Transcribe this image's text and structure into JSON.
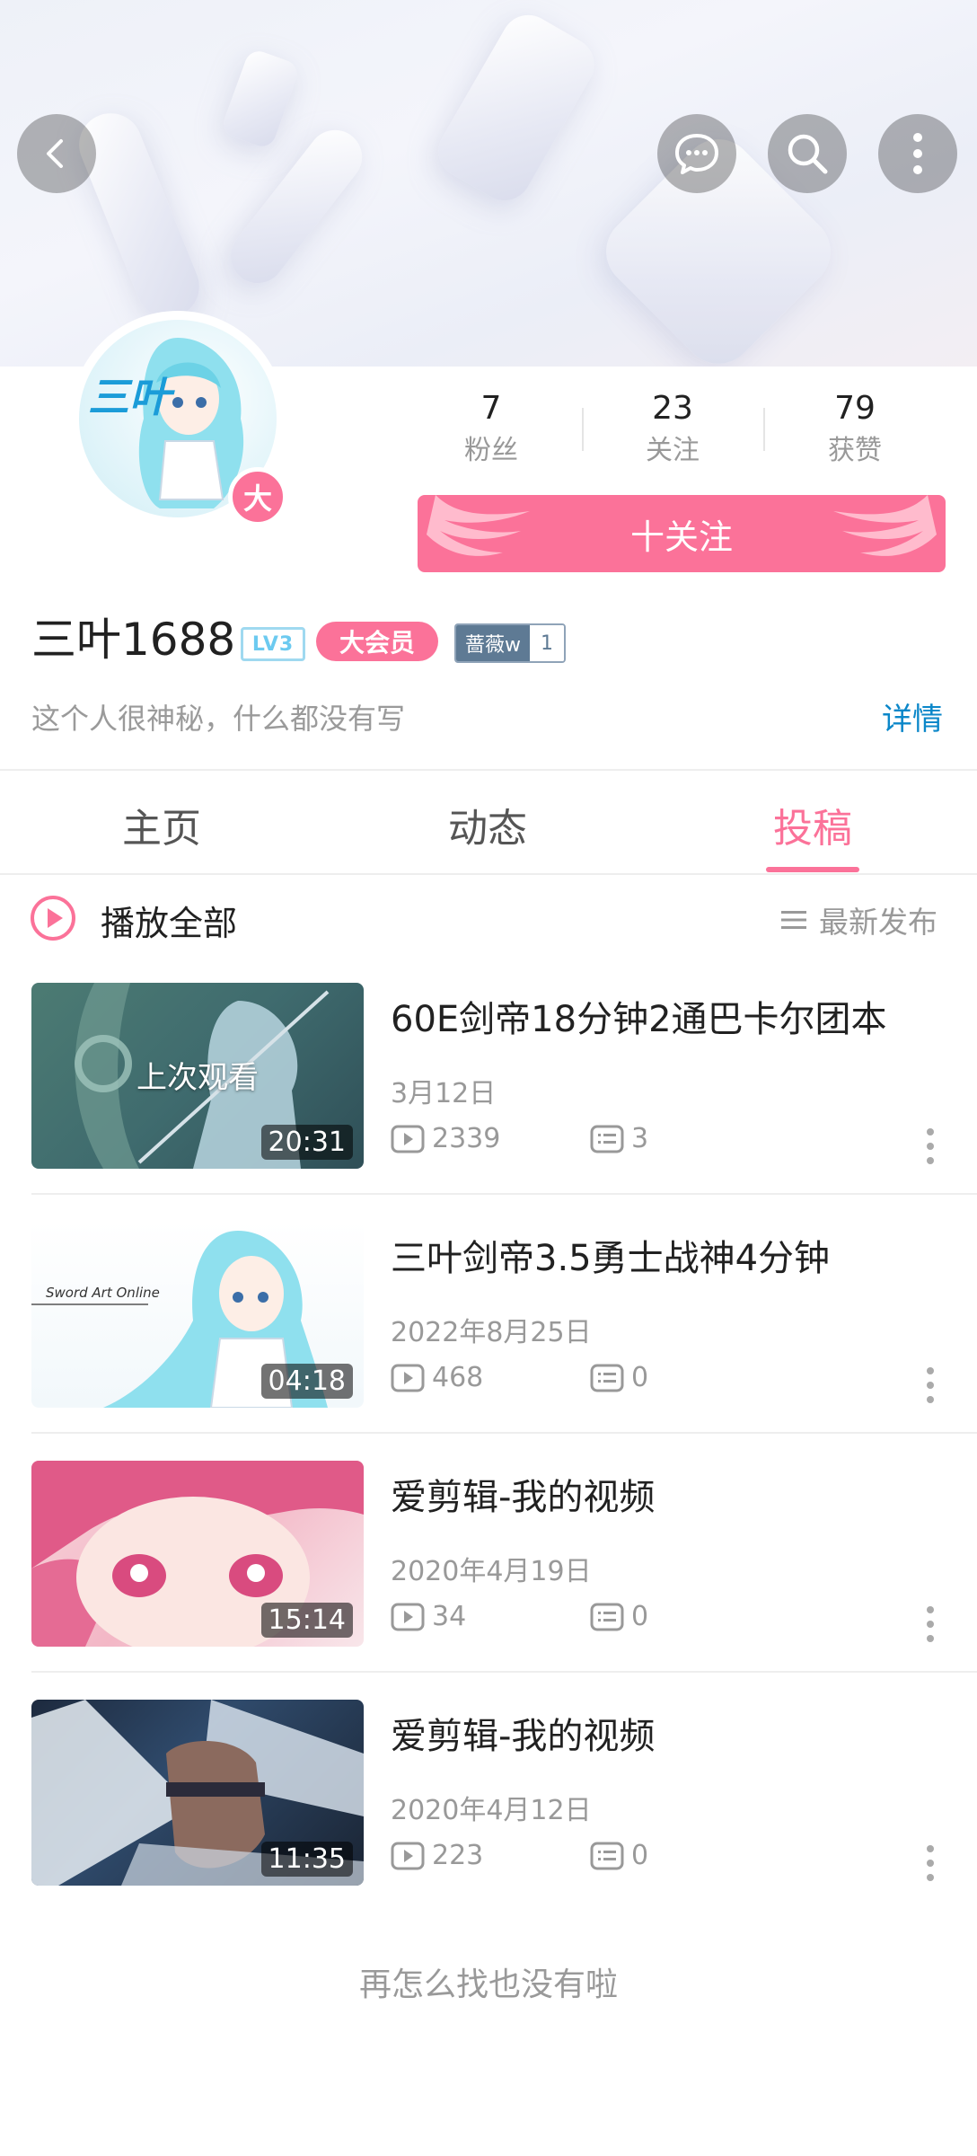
{
  "header": {
    "stats": [
      {
        "num": "7",
        "label": "粉丝"
      },
      {
        "num": "23",
        "label": "关注"
      },
      {
        "num": "79",
        "label": "获赞"
      }
    ],
    "follow_label": "十关注",
    "avatar_badge": "大",
    "avatar_logo": "三叶"
  },
  "profile": {
    "name": "三叶1688",
    "level": "LV3",
    "vip": "大会员",
    "medal_name": "蔷薇w",
    "medal_level": "1",
    "sign": "这个人很神秘，什么都没有写",
    "detail_link": "详情"
  },
  "tabs": [
    "主页",
    "动态",
    "投稿"
  ],
  "list_header": {
    "play_all": "播放全部",
    "sort": "最新发布"
  },
  "videos": [
    {
      "title": "60E剑帝18分钟2通巴卡尔团本",
      "date": "3月12日",
      "plays": "2339",
      "comments": "3",
      "duration": "20:31",
      "overlay": "上次观看"
    },
    {
      "title": "三叶剑帝3.5勇士战神4分钟",
      "date": "2022年8月25日",
      "plays": "468",
      "comments": "0",
      "duration": "04:18",
      "thumb_text": "Sword Art Online"
    },
    {
      "title": "爱剪辑-我的视频",
      "date": "2020年4月19日",
      "plays": "34",
      "comments": "0",
      "duration": "15:14"
    },
    {
      "title": "爱剪辑-我的视频",
      "date": "2020年4月12日",
      "plays": "223",
      "comments": "0",
      "duration": "11:35"
    }
  ],
  "footer": "再怎么找也没有啦",
  "colors": {
    "accent": "#fb7299",
    "link": "#0b87c9"
  }
}
